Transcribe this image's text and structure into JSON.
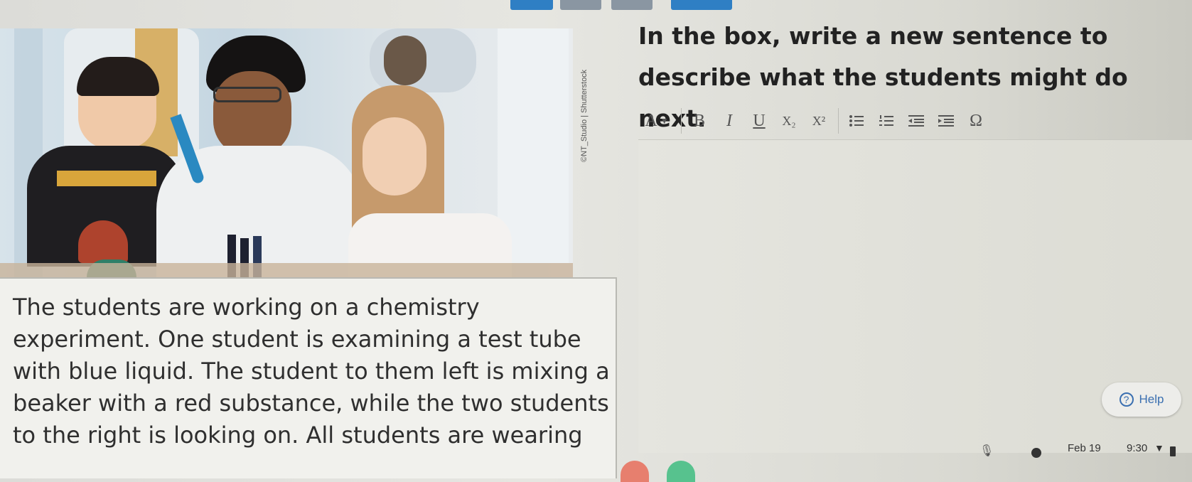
{
  "prompt": {
    "text": "In the box, write a new sentence to describe what the students might do next."
  },
  "photo": {
    "credit": "©NT_Studio | Shutterstock"
  },
  "caption": {
    "text": "The students are working on a chemistry\nexperiment. One student is examining a test tube\nwith blue liquid. The student to them left is mixing a\nbeaker with a red substance, while the two students\nto the right is looking on. All students are wearing"
  },
  "toolbar": {
    "font_color": "A",
    "bold": "B",
    "italic": "I",
    "underline": "U",
    "subscript": "X₂",
    "superscript": "X²",
    "special_char": "Ω"
  },
  "help": {
    "label": "Help",
    "icon_glyph": "?"
  },
  "status": {
    "date": "Feb 19",
    "time": "9:30"
  },
  "colors": {
    "accent_blue": "#2f7fc4",
    "help_blue": "#3a6fb0"
  }
}
